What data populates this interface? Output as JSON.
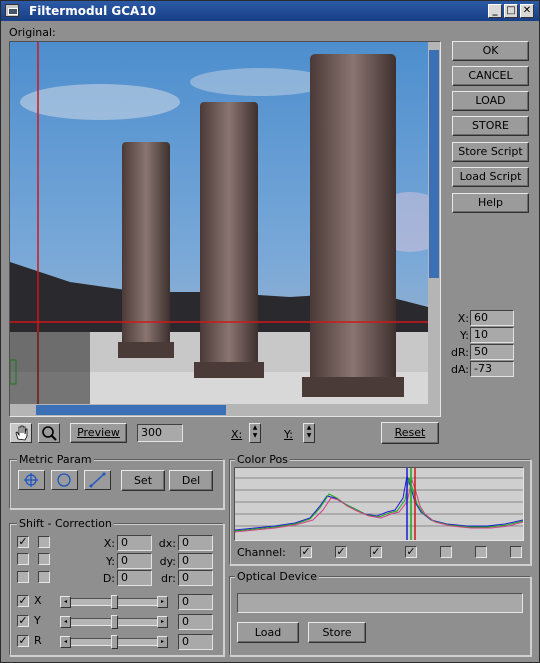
{
  "window": {
    "title": "Filtermodul GCA10"
  },
  "original_label": "Original:",
  "buttons": {
    "ok": "OK",
    "cancel": "CANCEL",
    "load": "LOAD",
    "store": "STORE",
    "store_script": "Store Script",
    "load_script": "Load Script",
    "help": "Help"
  },
  "coords": [
    {
      "label": "X:",
      "value": "60"
    },
    {
      "label": "Y:",
      "value": "10"
    },
    {
      "label": "dR:",
      "value": "50"
    },
    {
      "label": "dA:",
      "value": "-73"
    }
  ],
  "toolbar": {
    "preview": "Preview",
    "size": "300",
    "x_label": "X:",
    "y_label": "Y:",
    "reset": "Reset"
  },
  "metric": {
    "title": "Metric Param",
    "set": "Set",
    "del": "Del"
  },
  "shift": {
    "title": "Shift - Correction",
    "rows": [
      {
        "label": "X:",
        "value": "0",
        "dlabel": "dx:",
        "dvalue": "0"
      },
      {
        "label": "Y:",
        "value": "0",
        "dlabel": "dy:",
        "dvalue": "0"
      },
      {
        "label": "D:",
        "value": "0",
        "dlabel": "dr:",
        "dvalue": "0"
      }
    ],
    "sliders": [
      {
        "label": "X",
        "value": "0",
        "checked": true,
        "level": 0.5
      },
      {
        "label": "Y",
        "value": "0",
        "checked": true,
        "level": 0.5
      },
      {
        "label": "R",
        "value": "0",
        "checked": true,
        "level": 0.5
      }
    ],
    "checks": [
      [
        true,
        false
      ],
      [
        false,
        false
      ],
      [
        false,
        false
      ]
    ]
  },
  "color_pos": {
    "title": "Color Pos",
    "channel_label": "Channel:",
    "channels": [
      true,
      true,
      true,
      true,
      false,
      false,
      false
    ]
  },
  "optical": {
    "title": "Optical Device",
    "load": "Load",
    "store": "Store"
  },
  "colors": {
    "title_bar": "#1f4b95",
    "sky": "#4a8fc9",
    "crosshair": "#d01818",
    "scroll_thumb": "#3b6fb6"
  }
}
